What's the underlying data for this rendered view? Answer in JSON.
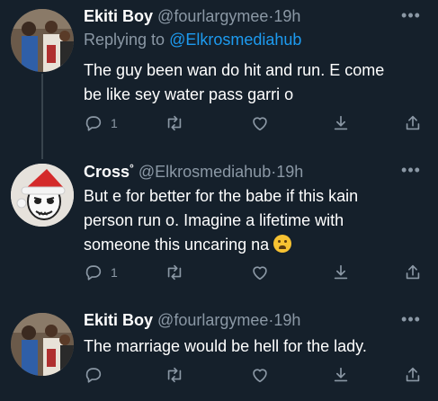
{
  "tweets": [
    {
      "name": "Ekiti Boy",
      "handle": "@fourlargymee",
      "dot": "·",
      "time": "19h",
      "reply_prefix": "Replying to ",
      "reply_to": "@Elkrosmediahub",
      "text_lines": [
        "The guy been wan do hit and run. E come",
        "be like sey water pass garri o"
      ],
      "reply_count": "1",
      "avatar": "crowd-photo-avatar"
    },
    {
      "name": "Cross",
      "name_suffix": "°",
      "handle": "@Elkrosmediahub",
      "dot": "·",
      "time": "19h",
      "text_lines": [
        "But e for better for the babe if this kain",
        "person run o. Imagine a lifetime with",
        "someone this uncaring na"
      ],
      "emoji": "weary-face-emoji",
      "reply_count": "1",
      "avatar": "santa-hat-cartoon-avatar"
    },
    {
      "name": "Ekiti Boy",
      "handle": "@fourlargymee",
      "dot": "·",
      "time": "19h",
      "text_lines": [
        "The marriage would be hell for the lady."
      ],
      "reply_count": "",
      "avatar": "crowd-photo-avatar"
    }
  ],
  "more_label": "•••",
  "colors": {
    "background": "#15202b",
    "text": "#ffffff",
    "secondary": "#8b98a5",
    "link": "#1d9bf0",
    "thread_line": "#38444d"
  },
  "icons": [
    "reply-icon",
    "retweet-icon",
    "like-icon",
    "bookmark-icon",
    "share-icon"
  ]
}
